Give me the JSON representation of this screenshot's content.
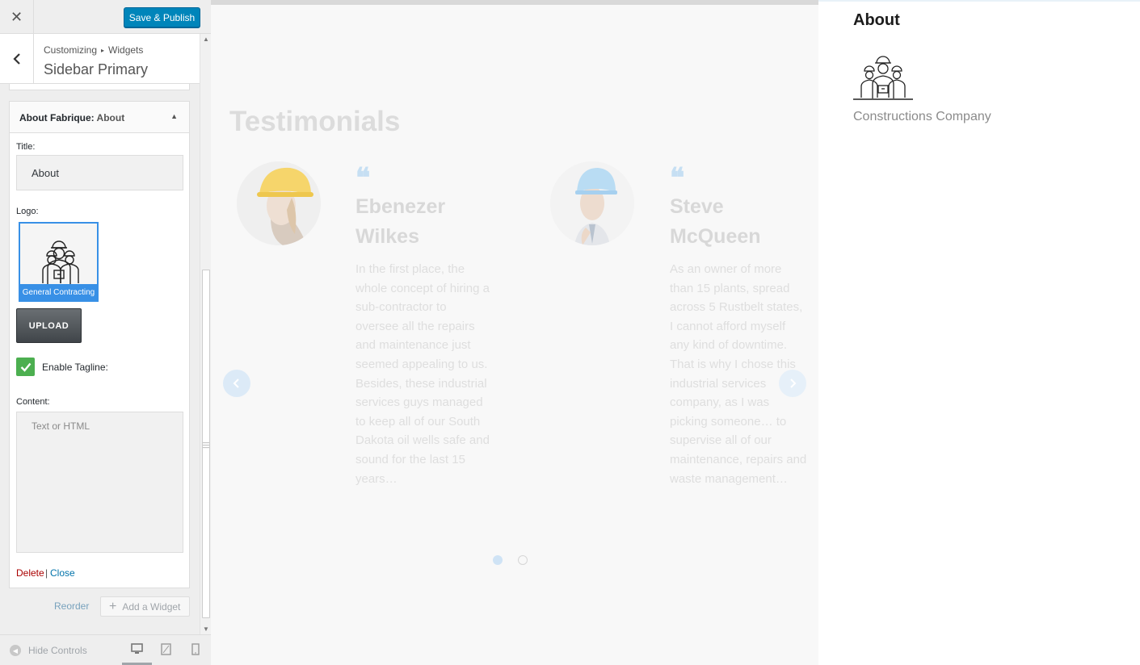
{
  "customizer": {
    "save_label": "Save & Publish",
    "breadcrumb_root": "Customizing",
    "breadcrumb_section": "Widgets",
    "section_title": "Sidebar Primary",
    "close_icon": "close-icon",
    "back_icon": "chevron-left-icon"
  },
  "widget": {
    "name": "About Fabrique:",
    "instance_title": "About",
    "title_label": "Title:",
    "title_value": "About",
    "logo_label": "Logo:",
    "logo_caption": "General Contracting",
    "upload_label": "UPLOAD",
    "tagline_label": "Enable Tagline:",
    "tagline_checked": true,
    "content_label": "Content:",
    "content_placeholder": "Text or HTML",
    "delete_label": "Delete",
    "separator": "|",
    "close_label": "Close"
  },
  "actions": {
    "reorder_label": "Reorder",
    "add_widget_label": "Add a Widget"
  },
  "footer": {
    "hide_controls_label": "Hide Controls",
    "devices": [
      "desktop-icon",
      "tablet-icon",
      "mobile-icon"
    ]
  },
  "preview": {
    "section_title": "Testimonials",
    "testimonials": [
      {
        "quote_mark": "❝",
        "name": "Ebenezer Wilkes",
        "text": "In the first place, the whole concept of hiring a sub-contractor to oversee all the repairs and maintenance just seemed appealing to us. Besides, these industrial services guys managed to keep all of our South Dakota oil wells safe and sound for the last 15 years…"
      },
      {
        "quote_mark": "❝",
        "name": "Steve McQueen",
        "text": "As an owner of more than 15 plants, spread across 5 Rustbelt states, I cannot afford myself any kind of downtime. That is why I chose this industrial services company, as I was picking someone… to supervise all of our maintenance, repairs and waste management…"
      }
    ],
    "slider_pages": 2,
    "slider_active_page": 1
  },
  "sidebar_widget": {
    "title": "About",
    "tagline": "Constructions Company"
  },
  "colors": {
    "primary_button": "#0085ba",
    "selection_blue": "#3890e6",
    "check_green": "#4caf50",
    "delete_red": "#aa0000",
    "link_blue": "#0073aa"
  }
}
